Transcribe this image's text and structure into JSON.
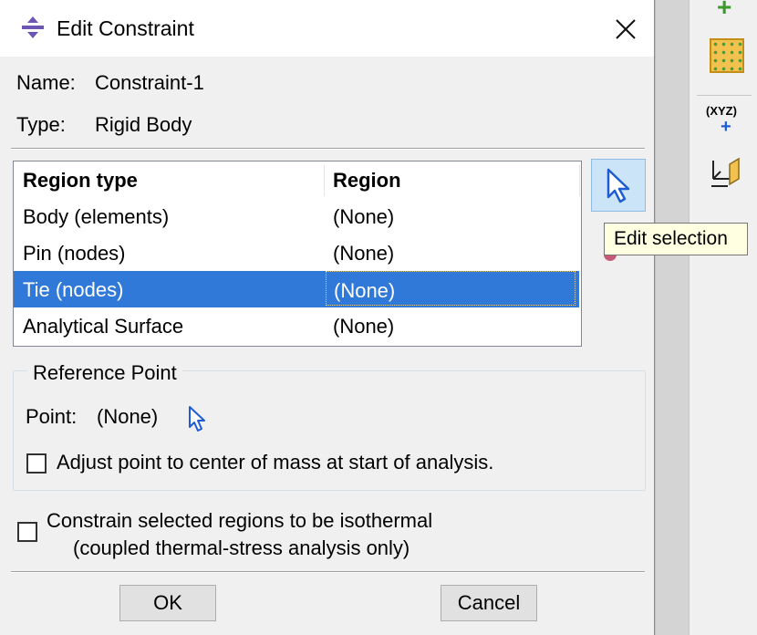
{
  "dialog": {
    "title": "Edit Constraint",
    "name_label": "Name:",
    "name_value": "Constraint-1",
    "type_label": "Type:",
    "type_value": "Rigid Body",
    "table": {
      "headers": [
        "Region type",
        "Region"
      ],
      "rows": [
        {
          "region_type": "Body (elements)",
          "region": "(None)"
        },
        {
          "region_type": "Pin (nodes)",
          "region": "(None)"
        },
        {
          "region_type": "Tie (nodes)",
          "region": "(None)",
          "selected": true
        },
        {
          "region_type": "Analytical Surface",
          "region": "(None)"
        }
      ]
    },
    "edit_selection_tooltip": "Edit selection",
    "reference_point": {
      "group_title": "Reference Point",
      "point_label": "Point:",
      "point_value": "(None)",
      "adjust_checkbox_label": "Adjust point to center of mass at start of analysis.",
      "adjust_checked": false
    },
    "isothermal": {
      "line1": "Constrain selected regions to be isothermal",
      "line2": "(coupled thermal-stress analysis only)",
      "checked": false
    },
    "buttons": {
      "ok": "OK",
      "cancel": "Cancel"
    }
  },
  "toolbar": {
    "xyz_label": "(XYZ)",
    "icons": [
      "plus-icon",
      "mesh-grid-icon",
      "xyz-point-icon",
      "datum-csys-icon"
    ]
  },
  "colors": {
    "selection": "#3179d8",
    "tooltip_bg": "#ffffe1",
    "button_face": "#e1e1e1",
    "edit_button_bg": "#cce4f7"
  }
}
